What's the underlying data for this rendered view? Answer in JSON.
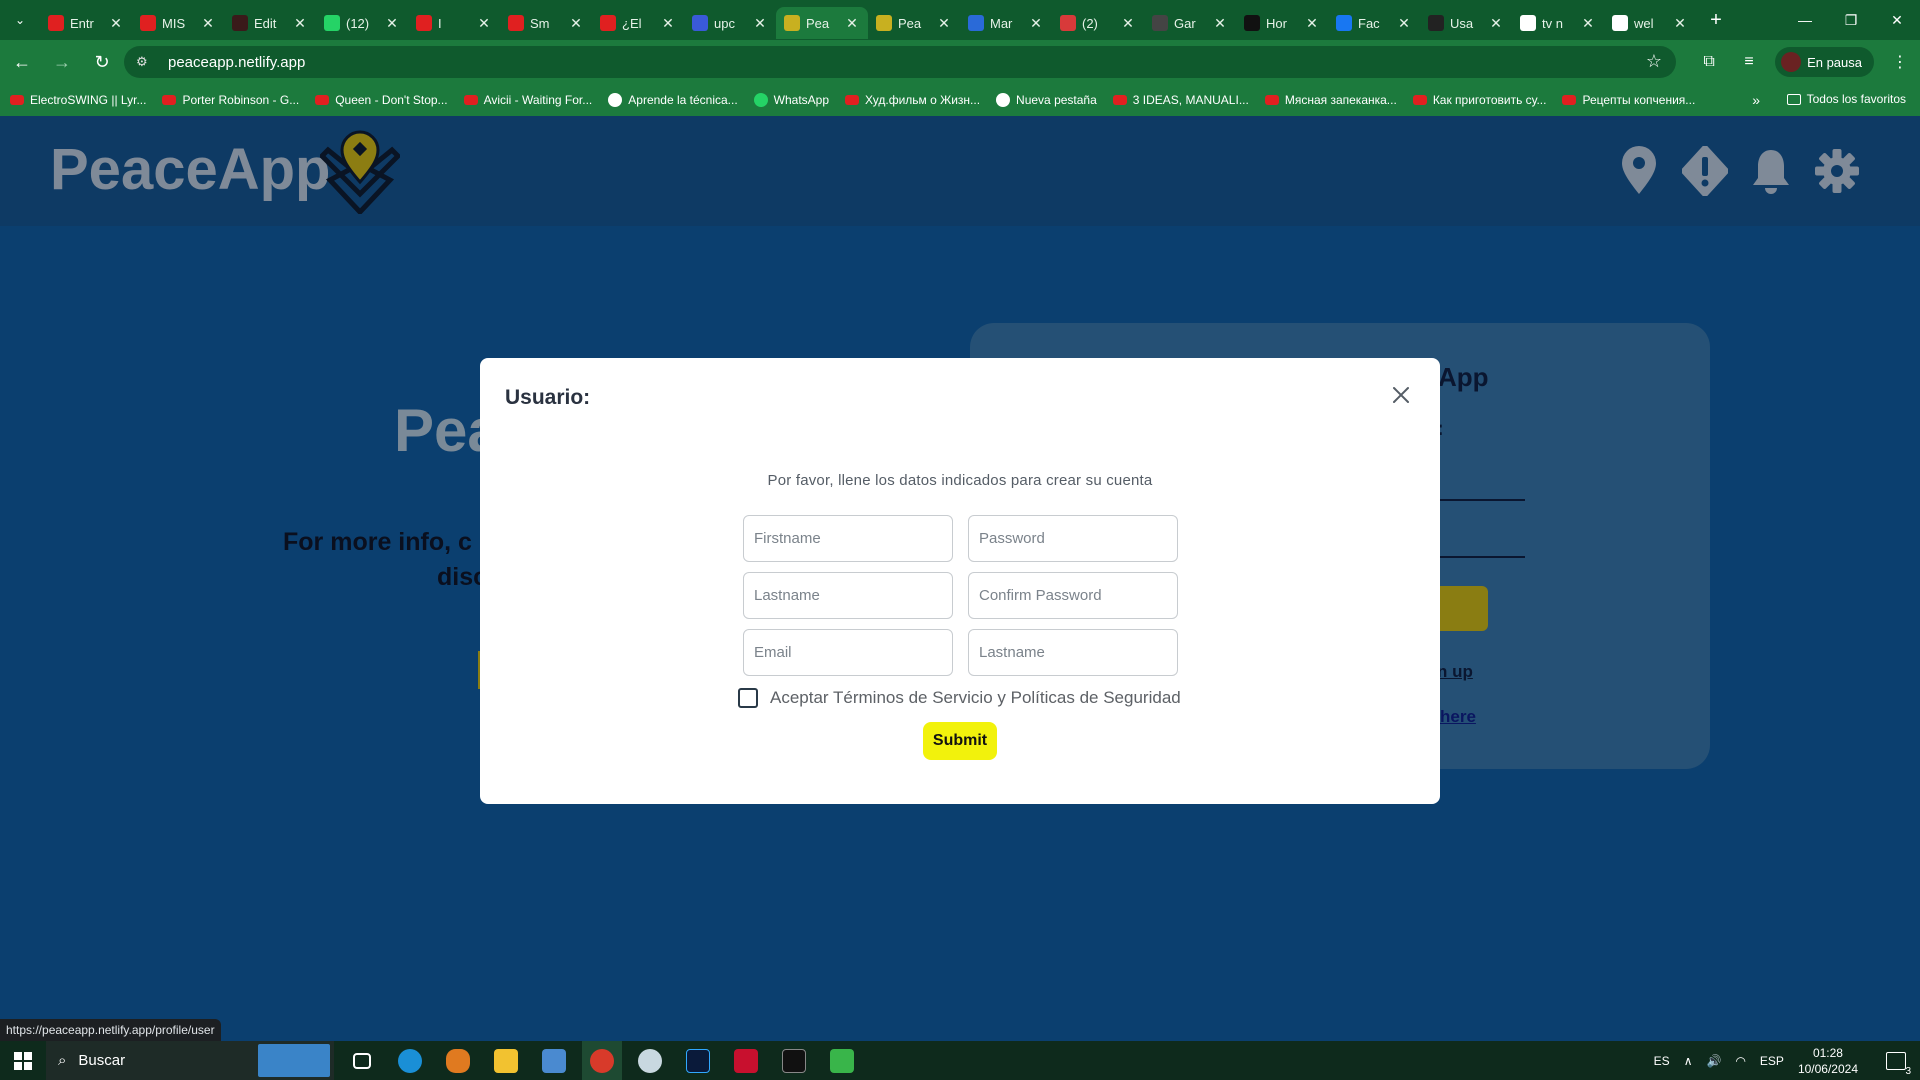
{
  "browser": {
    "tabs": [
      {
        "title": "Entr",
        "icon": "youtube-icon",
        "color": "#e02020"
      },
      {
        "title": "MIS",
        "icon": "youtube-icon",
        "color": "#e02020"
      },
      {
        "title": "Edit",
        "icon": "dark-app-icon",
        "color": "#3a1a1a"
      },
      {
        "title": "(12)",
        "icon": "whatsapp-icon",
        "color": "#25d366"
      },
      {
        "title": "I",
        "icon": "youtube-icon",
        "color": "#e02020"
      },
      {
        "title": "Sm",
        "icon": "youtube-icon",
        "color": "#e02020"
      },
      {
        "title": "¿El",
        "icon": "youtube-icon",
        "color": "#e02020"
      },
      {
        "title": "upc",
        "icon": "shield-app-icon",
        "color": "#3a5ad8"
      },
      {
        "title": "Pea",
        "icon": "peaceapp-icon",
        "color": "#c8b020"
      },
      {
        "title": "Pea",
        "icon": "peaceapp-icon",
        "color": "#c8b020"
      },
      {
        "title": "Mar",
        "icon": "board-icon",
        "color": "#2a6ad8"
      },
      {
        "title": "(2)",
        "icon": "chat-icon",
        "color": "#d83a3a"
      },
      {
        "title": "Gar",
        "icon": "bolt-icon",
        "color": "#444444"
      },
      {
        "title": "Hor",
        "icon": "x-icon",
        "color": "#111111"
      },
      {
        "title": "Fac",
        "icon": "facebook-icon",
        "color": "#1877f2"
      },
      {
        "title": "Usa",
        "icon": "openai-icon",
        "color": "#222222"
      },
      {
        "title": "tv n",
        "icon": "google-icon",
        "color": "#ffffff"
      },
      {
        "title": "wel",
        "icon": "google-icon",
        "color": "#ffffff"
      }
    ],
    "active_tab_index": 8,
    "url": "peaceapp.netlify.app",
    "profile_label": "En pausa",
    "bookmarks": [
      {
        "label": "ElectroSWING || Lyr...",
        "kind": "yt"
      },
      {
        "label": "Porter Robinson - G...",
        "kind": "yt"
      },
      {
        "label": "Queen - Don't Stop...",
        "kind": "yt"
      },
      {
        "label": "Avicii - Waiting For...",
        "kind": "yt"
      },
      {
        "label": "Aprende la técnica...",
        "kind": "gen"
      },
      {
        "label": "WhatsApp",
        "kind": "wa"
      },
      {
        "label": "Худ.фильм о Жизн...",
        "kind": "yt"
      },
      {
        "label": "Nueva pestaña",
        "kind": "gen"
      },
      {
        "label": "3 IDEAS, MANUALI...",
        "kind": "yt"
      },
      {
        "label": "Мясная запеканка...",
        "kind": "yt"
      },
      {
        "label": "Как приготовить су...",
        "kind": "yt"
      },
      {
        "label": "Рецепты копчения...",
        "kind": "yt"
      }
    ],
    "bookmarks_all": "Todos los favoritos",
    "status_url": "https://peaceapp.netlify.app/profile/user"
  },
  "app": {
    "brand": "PeaceApp",
    "header_icons": [
      "location-pin-icon",
      "alert-icon",
      "bell-icon",
      "settings-gear-icon"
    ],
    "background": {
      "title_fragment": "Pea",
      "info_line1": "For more info, c",
      "info_line2": "disc",
      "card_title_fragment": "App",
      "card_colon": ":",
      "signup_fragment": "n up",
      "here_link": "here"
    }
  },
  "modal": {
    "title": "Usuario:",
    "subtitle": "Por favor, llene los datos indicados para crear su cuenta",
    "fields": {
      "firstname": "Firstname",
      "password": "Password",
      "lastname": "Lastname",
      "confirm_password": "Confirm Password",
      "email": "Email",
      "lastname_2": "Lastname"
    },
    "terms_label": "Aceptar Términos de Servicio y Políticas de Seguridad",
    "terms_checked": false,
    "submit_label": "Submit"
  },
  "taskbar": {
    "search_placeholder": "Buscar",
    "lang": "ES",
    "keyboard": "ESP",
    "time": "01:28",
    "date": "10/06/2024",
    "notification_count": "3"
  },
  "colors": {
    "chrome_dark": "#0f5a2d",
    "chrome": "#1c7a3d",
    "page_bg": "#0b3f6f",
    "accent_yellow": "#f2f20c"
  }
}
